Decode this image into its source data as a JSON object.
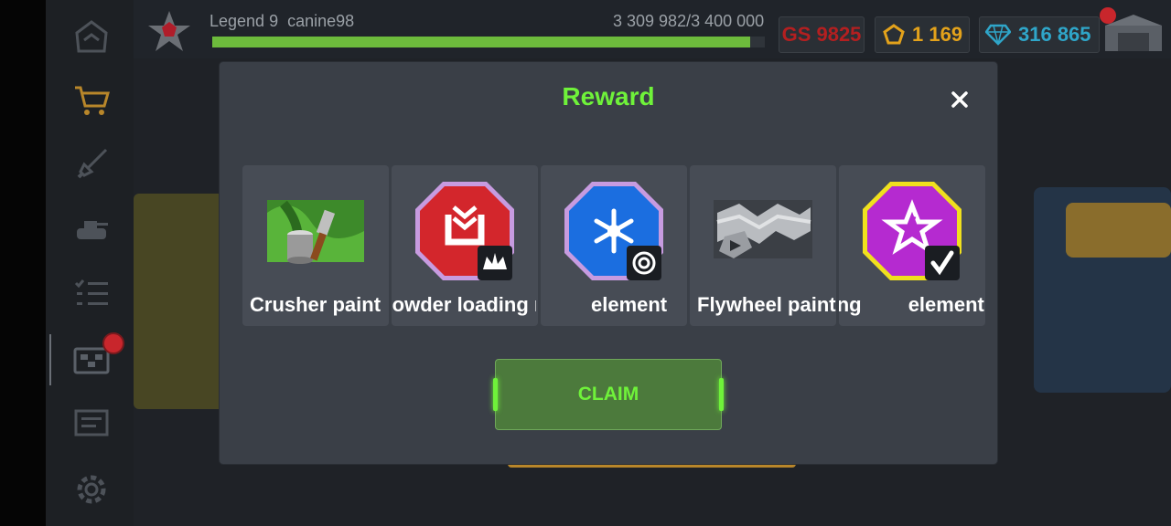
{
  "player": {
    "rank": "Legend 9",
    "username": "canine98",
    "xp": "3 309 982/3 400 000",
    "xp_progress": 0.9734
  },
  "stats": {
    "gs": "GS 9825",
    "gold": "1 169",
    "gems": "316 865"
  },
  "sidebar": {
    "items": [
      "home-icon",
      "shop-icon",
      "weapons-icon",
      "hangar-icon",
      "tasks-icon",
      "crates-icon",
      "news-icon",
      "settings-icon"
    ]
  },
  "modal": {
    "title": "Reward",
    "claim_label": "CLAIM",
    "rewards": [
      {
        "label": "Crusher paint",
        "icon": "paint-icon"
      },
      {
        "label": "Powder loading m",
        "icon": "module-icon"
      },
      {
        "label": "Cold element",
        "icon": "cold-element-icon"
      },
      {
        "label": "Flywheel paint",
        "icon": "flywheel-paint-icon"
      },
      {
        "label": "Jamming element",
        "icon": "jamming-element-icon"
      }
    ]
  },
  "colors": {
    "accent_green": "#6ff23a",
    "gs_red": "#b41f20",
    "gold": "#e3a21b",
    "gem": "#2fa6c9"
  }
}
